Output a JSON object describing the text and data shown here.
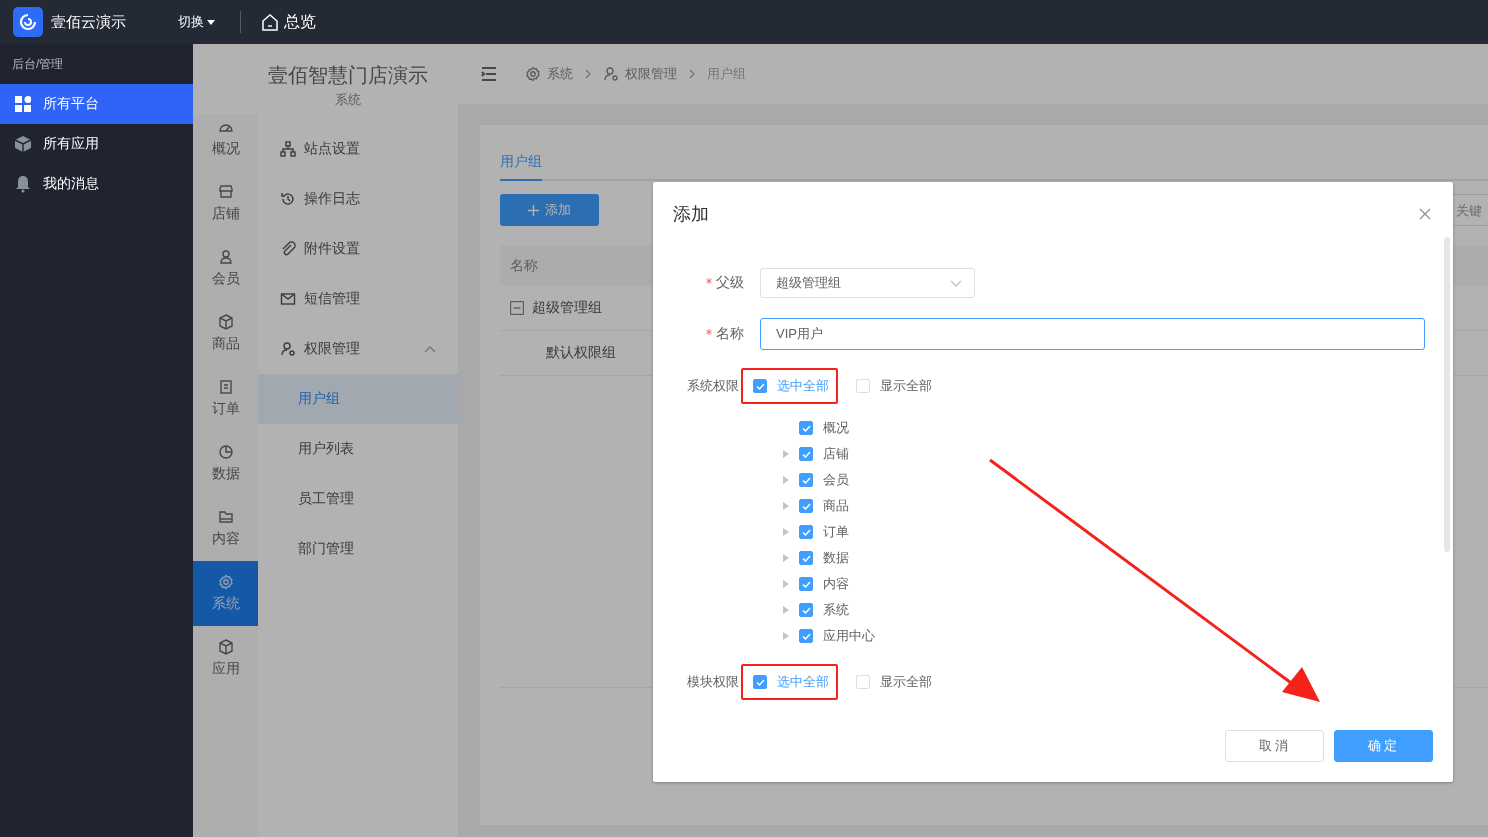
{
  "top_bar": {
    "brand": "壹佰云演示",
    "switch": "切换",
    "overview": "总览"
  },
  "sidebar": {
    "section": "后台/管理",
    "items": [
      {
        "label": "所有平台",
        "selected": true
      },
      {
        "label": "所有应用",
        "selected": false
      },
      {
        "label": "我的消息",
        "selected": false
      }
    ]
  },
  "app": {
    "title": "壹佰智慧门店演示",
    "subtitle": "系统",
    "rail": [
      {
        "label": "概况",
        "selected": false
      },
      {
        "label": "店铺",
        "selected": false
      },
      {
        "label": "会员",
        "selected": false
      },
      {
        "label": "商品",
        "selected": false
      },
      {
        "label": "订单",
        "selected": false
      },
      {
        "label": "数据",
        "selected": false
      },
      {
        "label": "内容",
        "selected": false
      },
      {
        "label": "系统",
        "selected": true
      },
      {
        "label": "应用",
        "selected": false
      }
    ],
    "submenu": [
      {
        "label": "站点设置"
      },
      {
        "label": "操作日志"
      },
      {
        "label": "附件设置"
      },
      {
        "label": "短信管理"
      },
      {
        "label": "权限管理",
        "expanded": true,
        "children": [
          {
            "label": "用户组",
            "selected": true
          },
          {
            "label": "用户列表",
            "selected": false
          },
          {
            "label": "员工管理",
            "selected": false
          },
          {
            "label": "部门管理",
            "selected": false
          }
        ]
      }
    ],
    "breadcrumb": [
      "系统",
      "权限管理",
      "用户组"
    ],
    "tabs": [
      {
        "label": "用户组",
        "selected": true
      }
    ],
    "add_button": "添加",
    "search": {
      "placeholder": "关键"
    },
    "table": {
      "columns": [
        "名称"
      ],
      "rows": [
        {
          "name": "超级管理组",
          "expanded": true,
          "children": [
            {
              "name": "默认权限组"
            }
          ]
        }
      ]
    }
  },
  "dialog": {
    "title": "添加",
    "fields": [
      {
        "kind": "select",
        "label": "父级",
        "required": true,
        "value": "超级管理组"
      },
      {
        "kind": "input",
        "label": "名称",
        "required": true,
        "value": "VIP用户"
      }
    ],
    "permissions": [
      {
        "label": "系统权限",
        "select_all": {
          "label": "选中全部",
          "checked": true
        },
        "show_all": {
          "label": "显示全部",
          "checked": false
        },
        "items": [
          {
            "label": "概况",
            "checked": true,
            "expandable": false
          },
          {
            "label": "店铺",
            "checked": true,
            "expandable": true
          },
          {
            "label": "会员",
            "checked": true,
            "expandable": true
          },
          {
            "label": "商品",
            "checked": true,
            "expandable": true
          },
          {
            "label": "订单",
            "checked": true,
            "expandable": true
          },
          {
            "label": "数据",
            "checked": true,
            "expandable": true
          },
          {
            "label": "内容",
            "checked": true,
            "expandable": true
          },
          {
            "label": "系统",
            "checked": true,
            "expandable": true
          },
          {
            "label": "应用中心",
            "checked": true,
            "expandable": true
          }
        ]
      },
      {
        "label": "模块权限",
        "select_all": {
          "label": "选中全部",
          "checked": true
        },
        "show_all": {
          "label": "显示全部",
          "checked": false
        }
      }
    ],
    "buttons": [
      {
        "kind": "secondary",
        "label": "取消"
      },
      {
        "kind": "primary",
        "label": "确定"
      }
    ]
  }
}
